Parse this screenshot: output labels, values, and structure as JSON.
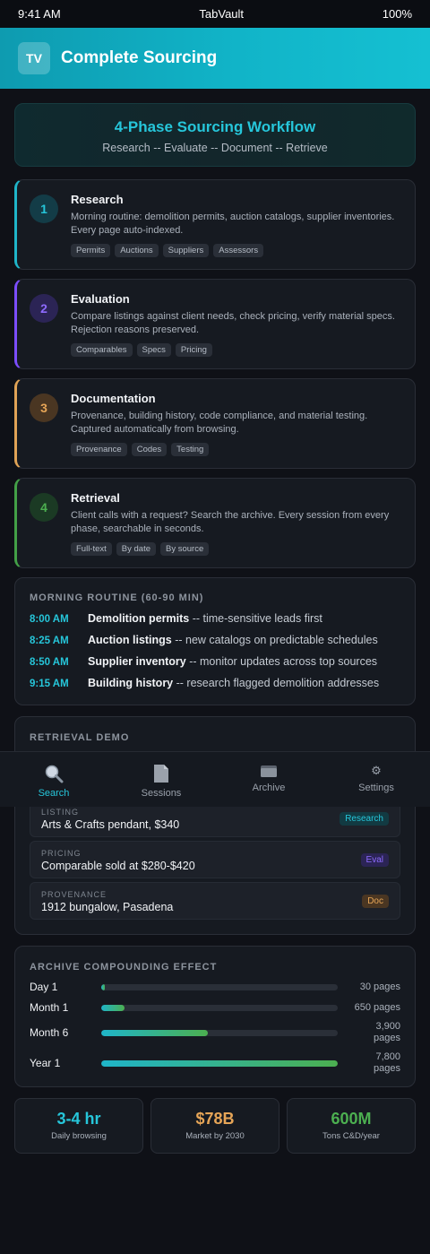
{
  "status": {
    "time": "9:41 AM",
    "app": "TabVault",
    "battery": "100%"
  },
  "header": {
    "logo": "TV",
    "title": "Complete Sourcing"
  },
  "hero": {
    "title": "4-Phase Sourcing Workflow",
    "subtitle": "Research -- Evaluate -- Document -- Retrieve"
  },
  "phases": [
    {
      "num": "1",
      "title": "Research",
      "desc": "Morning routine: demolition permits, auction catalogs, supplier inventories. Every page auto-indexed.",
      "tags": [
        "Permits",
        "Auctions",
        "Suppliers",
        "Assessors"
      ]
    },
    {
      "num": "2",
      "title": "Evaluation",
      "desc": "Compare listings against client needs, check pricing, verify material specs. Rejection reasons preserved.",
      "tags": [
        "Comparables",
        "Specs",
        "Pricing"
      ]
    },
    {
      "num": "3",
      "title": "Documentation",
      "desc": "Provenance, building history, code compliance, and material testing. Captured automatically from browsing.",
      "tags": [
        "Provenance",
        "Codes",
        "Testing"
      ]
    },
    {
      "num": "4",
      "title": "Retrieval",
      "desc": "Client calls with a request? Search the archive. Every session from every phase, searchable in seconds.",
      "tags": [
        "Full-text",
        "By date",
        "By source"
      ]
    }
  ],
  "routine": {
    "label": "MORNING ROUTINE (60-90 MIN)",
    "items": [
      {
        "time": "8:00 AM",
        "title": "Demolition permits",
        "desc": " -- time-sensitive leads first"
      },
      {
        "time": "8:25 AM",
        "title": "Auction listings",
        "desc": " -- new catalogs on predictable schedules"
      },
      {
        "time": "8:50 AM",
        "title": "Supplier inventory",
        "desc": " -- monitor updates across top sources"
      },
      {
        "time": "9:15 AM",
        "title": "Building history",
        "desc": " -- research flagged demolition addresses"
      }
    ]
  },
  "demo": {
    "label": "RETRIEVAL DEMO",
    "items": [
      {
        "label": "LISTING",
        "value": "Arts & Crafts pendant, $340",
        "badge": "Research"
      },
      {
        "label": "PRICING",
        "value": "Comparable sold at $280-$420",
        "badge": "Eval"
      },
      {
        "label": "PROVENANCE",
        "value": "1912 bungalow, Pasadena",
        "badge": "Doc"
      }
    ]
  },
  "tabs": [
    {
      "label": "Search",
      "icon": "search-icon"
    },
    {
      "label": "Sessions",
      "icon": "document-icon"
    },
    {
      "label": "Archive",
      "icon": "folder-icon"
    },
    {
      "label": "Settings",
      "icon": "gear-icon"
    }
  ],
  "archive": {
    "label": "ARCHIVE COMPOUNDING EFFECT",
    "rows": [
      {
        "label": "Day 1",
        "value": "30 pages",
        "fraction": 0.015
      },
      {
        "label": "Month 1",
        "value": "650 pages",
        "fraction": 0.1
      },
      {
        "label": "Month 6",
        "value_line1": "3,900",
        "value_line2": "pages",
        "fraction": 0.45
      },
      {
        "label": "Year 1",
        "value_line1": "7,800",
        "value_line2": "pages",
        "fraction": 1.0
      }
    ]
  },
  "stats": [
    {
      "value": "3-4 hr",
      "label": "Daily browsing",
      "color": "#26c6da"
    },
    {
      "value": "$78B",
      "label": "Market by 2030",
      "color": "#e6a557"
    },
    {
      "value": "600M",
      "label": "Tons C&D/year",
      "color": "#4caf50"
    }
  ]
}
